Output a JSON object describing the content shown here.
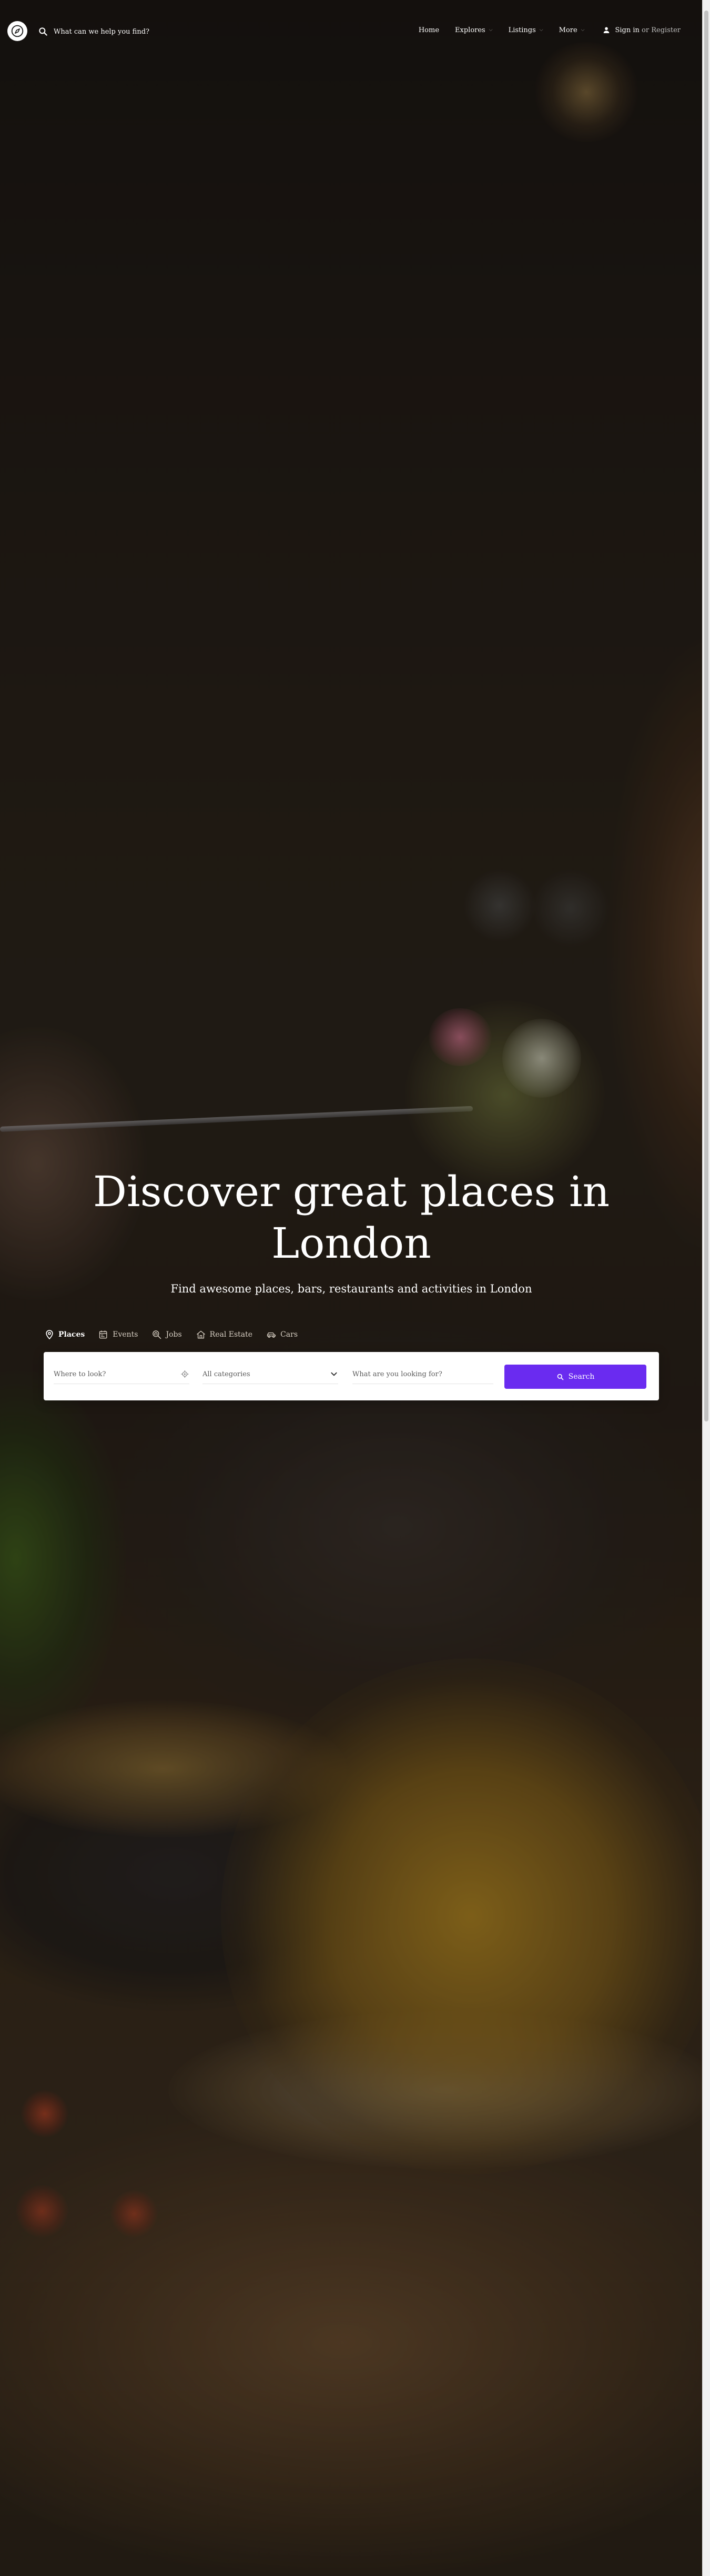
{
  "header": {
    "search_placeholder": "What can we help you find?",
    "nav": [
      {
        "label": "Home",
        "has_dropdown": false
      },
      {
        "label": "Explores",
        "has_dropdown": true
      },
      {
        "label": "Listings",
        "has_dropdown": true
      },
      {
        "label": "More",
        "has_dropdown": true
      }
    ],
    "signin": {
      "sign_in": "Sign in",
      "separator": "or",
      "register": "Register"
    }
  },
  "hero": {
    "title_line1": "Discover great places in",
    "title_line2": "London",
    "subtitle": "Find awesome places, bars, restaurants and activities in London"
  },
  "tabs": [
    {
      "label": "Places",
      "icon": "map-pin-icon",
      "active": true
    },
    {
      "label": "Events",
      "icon": "calendar-icon",
      "active": false
    },
    {
      "label": "Jobs",
      "icon": "briefcase-search-icon",
      "active": false
    },
    {
      "label": "Real Estate",
      "icon": "house-icon",
      "active": false
    },
    {
      "label": "Cars",
      "icon": "car-icon",
      "active": false
    }
  ],
  "search": {
    "where_placeholder": "Where to look?",
    "category_value": "All categories",
    "what_placeholder": "What are you looking for?",
    "button_label": "Search"
  },
  "colors": {
    "accent": "#6a2bf0",
    "header_text": "#ffffff",
    "dropdown_chevron": "#9a9a9a"
  }
}
